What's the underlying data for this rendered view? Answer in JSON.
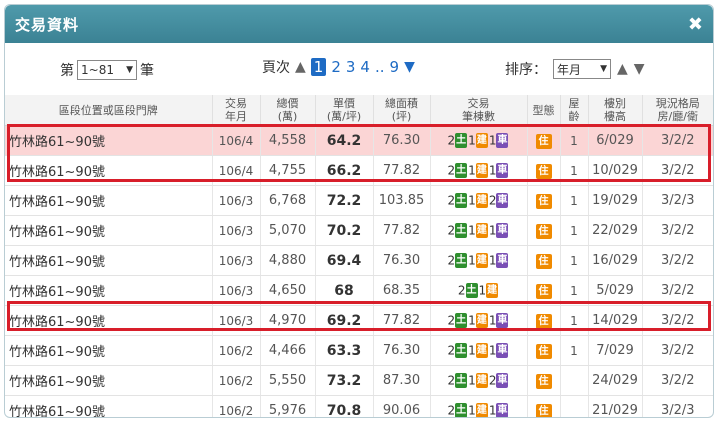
{
  "dialog": {
    "title": "交易資料",
    "close_icon": "✖"
  },
  "controls": {
    "page_prefix": "第",
    "page_range": "1~81",
    "page_suffix": "筆",
    "pages_label": "頁次",
    "pages": [
      "1",
      "2",
      "3",
      "4"
    ],
    "ellipsis": "..",
    "last_page": "9",
    "sort_label": "排序：",
    "sort_value": "年月"
  },
  "headers": [
    [
      "區段位置或區段門牌"
    ],
    [
      "交易",
      "年月"
    ],
    [
      "總價",
      "(萬)"
    ],
    [
      "單價",
      "(萬/坪)"
    ],
    [
      "總面積",
      "(坪)"
    ],
    [
      "交易",
      "筆棟數"
    ],
    [
      "型態"
    ],
    [
      "屋",
      "齡"
    ],
    [
      "樓別",
      "樓高"
    ],
    [
      "現況格局",
      "房/廳/衛"
    ]
  ],
  "chips": {
    "land": "土",
    "building": "建",
    "parking": "車",
    "type": "住"
  },
  "rows": [
    {
      "addr": "竹林路61~90號",
      "ym": "106/4",
      "total": "4,558",
      "unit": "64.2",
      "area": "76.30",
      "land": "2",
      "bldg": "1",
      "park": "1",
      "age": "1",
      "floor": "6/029",
      "layout": "3/2/2",
      "hl": true
    },
    {
      "addr": "竹林路61~90號",
      "ym": "106/4",
      "total": "4,755",
      "unit": "66.2",
      "area": "77.82",
      "land": "2",
      "bldg": "1",
      "park": "1",
      "age": "1",
      "floor": "10/029",
      "layout": "3/2/2",
      "hl": false
    },
    {
      "addr": "竹林路61~90號",
      "ym": "106/3",
      "total": "6,768",
      "unit": "72.2",
      "area": "103.85",
      "land": "2",
      "bldg": "1",
      "park": "2",
      "age": "1",
      "floor": "19/029",
      "layout": "3/2/3",
      "hl": false
    },
    {
      "addr": "竹林路61~90號",
      "ym": "106/3",
      "total": "5,070",
      "unit": "70.2",
      "area": "77.82",
      "land": "2",
      "bldg": "1",
      "park": "1",
      "age": "1",
      "floor": "22/029",
      "layout": "3/2/2",
      "hl": false
    },
    {
      "addr": "竹林路61~90號",
      "ym": "106/3",
      "total": "4,880",
      "unit": "69.4",
      "area": "76.30",
      "land": "2",
      "bldg": "1",
      "park": "1",
      "age": "1",
      "floor": "16/029",
      "layout": "3/2/2",
      "hl": false
    },
    {
      "addr": "竹林路61~90號",
      "ym": "106/3",
      "total": "4,650",
      "unit": "68",
      "area": "68.35",
      "land": "2",
      "bldg": "1",
      "park": "",
      "age": "1",
      "floor": "5/029",
      "layout": "3/2/2",
      "hl": false
    },
    {
      "addr": "竹林路61~90號",
      "ym": "106/3",
      "total": "4,970",
      "unit": "69.2",
      "area": "77.82",
      "land": "2",
      "bldg": "1",
      "park": "1",
      "age": "1",
      "floor": "14/029",
      "layout": "3/2/2",
      "hl": false
    },
    {
      "addr": "竹林路61~90號",
      "ym": "106/2",
      "total": "4,466",
      "unit": "63.3",
      "area": "76.30",
      "land": "2",
      "bldg": "1",
      "park": "1",
      "age": "1",
      "floor": "7/029",
      "layout": "3/2/2",
      "hl": false
    },
    {
      "addr": "竹林路61~90號",
      "ym": "106/2",
      "total": "5,550",
      "unit": "73.2",
      "area": "87.30",
      "land": "2",
      "bldg": "1",
      "park": "2",
      "age": "",
      "floor": "24/029",
      "layout": "3/2/2",
      "hl": false
    },
    {
      "addr": "竹林路61~90號",
      "ym": "106/2",
      "total": "5,976",
      "unit": "70.8",
      "area": "90.06",
      "land": "2",
      "bldg": "1",
      "park": "1",
      "age": "",
      "floor": "21/029",
      "layout": "3/2/3",
      "hl": false
    }
  ],
  "colors": {
    "title_bar": "#3b8294",
    "highlight_row": "#fbd5d5",
    "red_box": "#d81e2a",
    "land": "#2f8f2f",
    "building": "#f08a00",
    "parking": "#7a4fb5",
    "page_link": "#1e6bc4"
  }
}
